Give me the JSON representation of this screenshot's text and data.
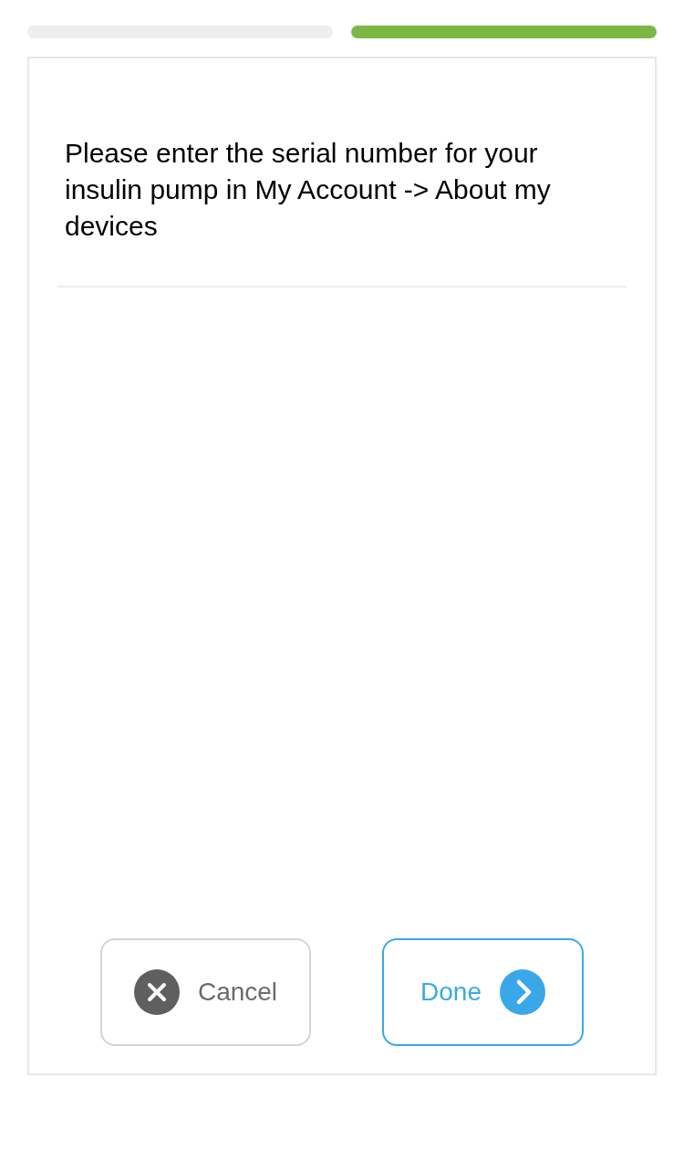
{
  "progress_steps": [
    {
      "active": false
    },
    {
      "active": true
    }
  ],
  "card": {
    "message": "Please enter the serial number for your insulin pump in My Account -> About my devices"
  },
  "buttons": [
    {
      "kind": "cancel",
      "label": "Cancel"
    },
    {
      "kind": "done",
      "label": "Done"
    }
  ]
}
